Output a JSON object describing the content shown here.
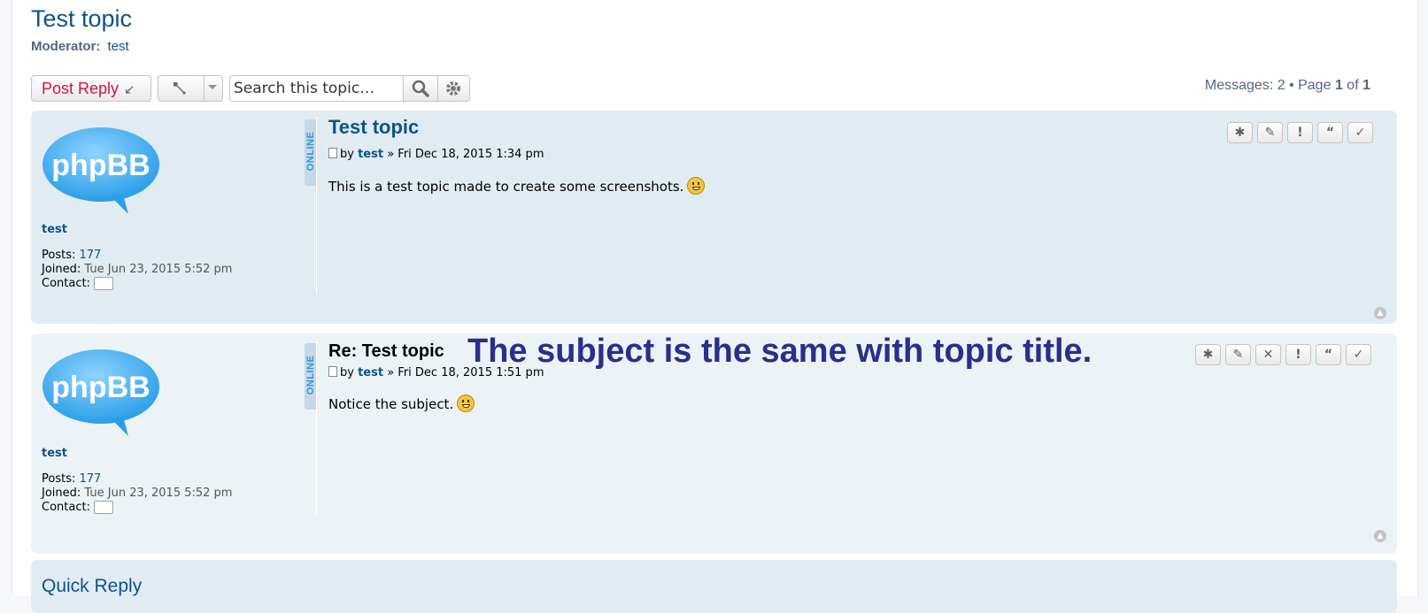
{
  "topic": {
    "title": "Test topic",
    "moderator_label": "Moderator:",
    "moderator_name": "test"
  },
  "toolbar": {
    "post_reply_label": "Post Reply",
    "post_reply_icon": "reply-arrow-icon",
    "tools_icon": "wrench-icon",
    "dropdown_icon": "caret-down-icon",
    "search_placeholder": "Search this topic…",
    "search_icon": "magnifier-icon",
    "advanced_search_icon": "gear-icon"
  },
  "pagination": {
    "messages_label": "Messages: 2 • Page",
    "current_page": "1",
    "of_label": "of",
    "total_pages": "1"
  },
  "posts": [
    {
      "avatar_text": "phpBB",
      "online_label": "ONLINE",
      "username": "test",
      "posts_label": "Posts:",
      "posts_value": "177",
      "joined_label": "Joined:",
      "joined_value": "Tue Jun 23, 2015 5:52 pm",
      "contact_label": "Contact:",
      "subject": "Test topic",
      "by_label": "by",
      "author": "test",
      "date": "» Fri Dec 18, 2015 1:34 pm",
      "content": "This is a test topic made to create some screenshots.",
      "actions": [
        "✱",
        "✎",
        "!",
        "“",
        "✓"
      ]
    },
    {
      "avatar_text": "phpBB",
      "online_label": "ONLINE",
      "username": "test",
      "posts_label": "Posts:",
      "posts_value": "177",
      "joined_label": "Joined:",
      "joined_value": "Tue Jun 23, 2015 5:52 pm",
      "contact_label": "Contact:",
      "subject": "Re: Test topic",
      "by_label": "by",
      "author": "test",
      "date": "» Fri Dec 18, 2015 1:51 pm",
      "content": "Notice the subject.",
      "actions": [
        "✱",
        "✎",
        "✕",
        "!",
        "“",
        "✓"
      ]
    }
  ],
  "annotation": "The subject is the same with topic title.",
  "quick_reply": {
    "title": "Quick Reply"
  },
  "colors": {
    "link": "#105289",
    "post_reply": "#d31141",
    "post_bg_1": "#e1ebf2",
    "post_bg_2": "#ecf3f7",
    "annotation": "#2a2e8c"
  }
}
